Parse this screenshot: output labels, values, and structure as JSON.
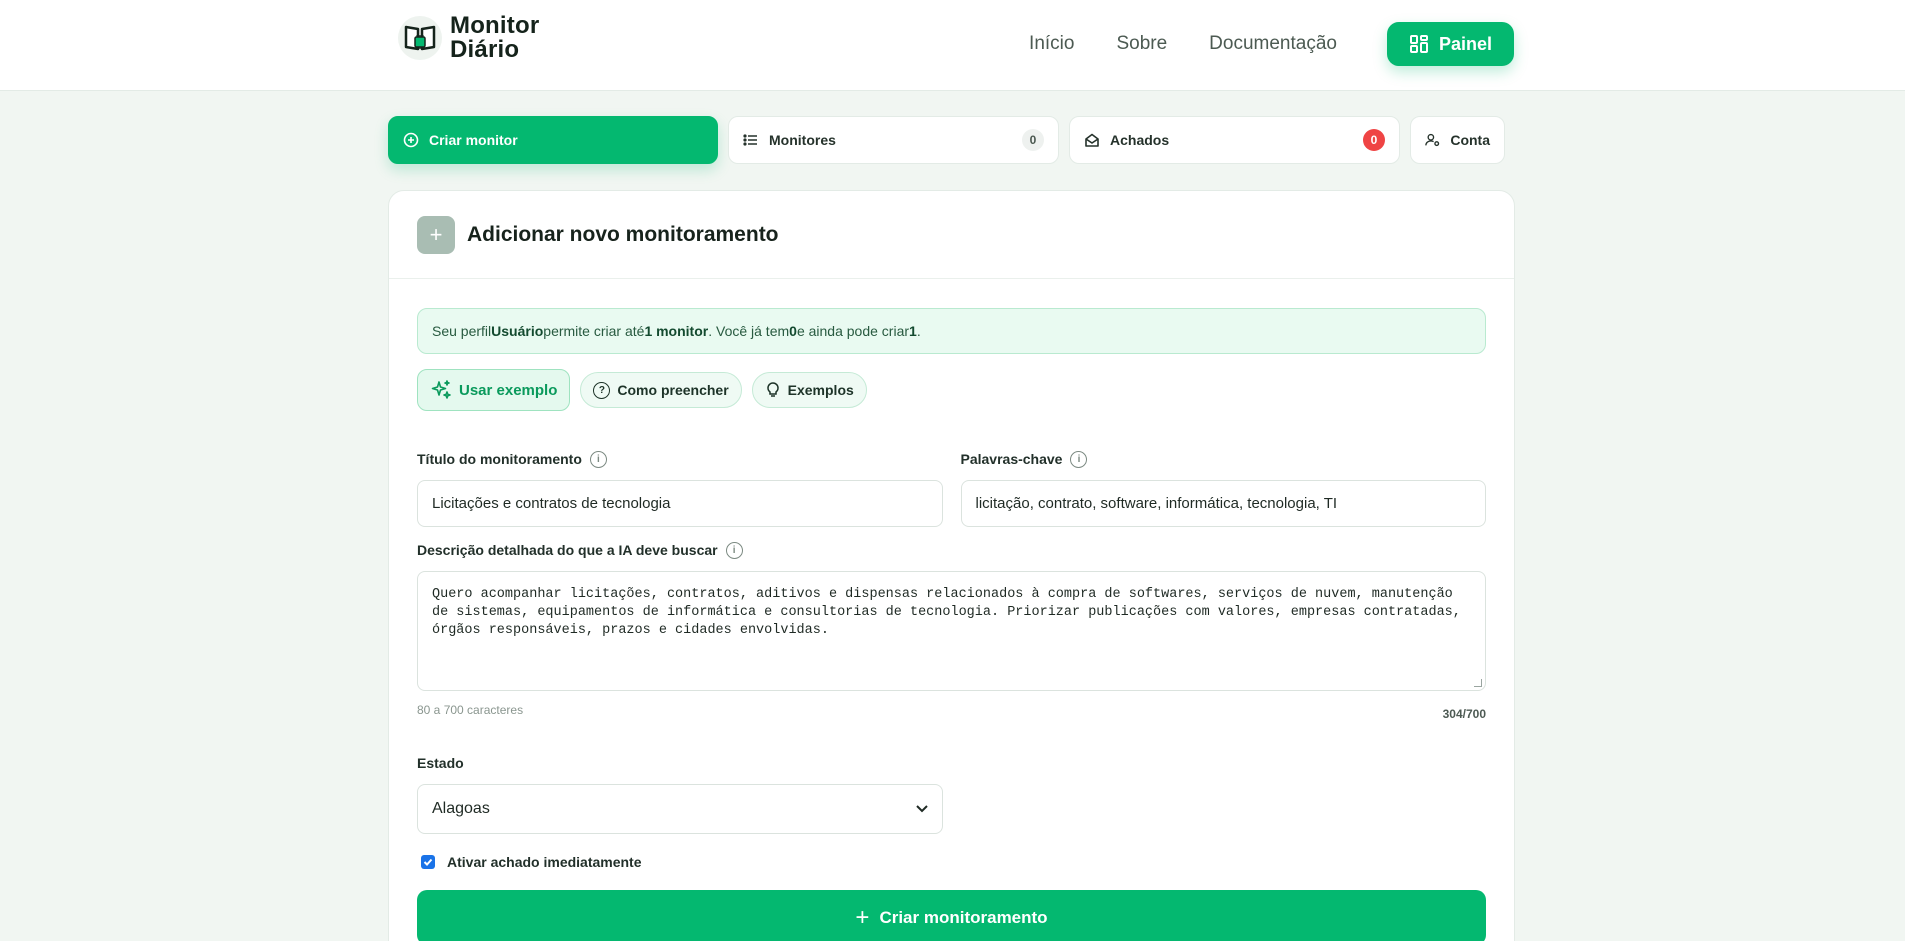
{
  "brand": {
    "line1": "Monitor",
    "line2": "Diário"
  },
  "nav": {
    "links": [
      "Início",
      "Sobre",
      "Documentação"
    ],
    "painel_label": "Painel"
  },
  "tabs": [
    {
      "label": "Criar monitor",
      "icon": "plus-circle-icon",
      "active": true
    },
    {
      "label": "Monitores",
      "icon": "list-icon",
      "count": "0"
    },
    {
      "label": "Achados",
      "icon": "envelope-open-icon",
      "count": "0"
    },
    {
      "label": "Conta",
      "icon": "user-gear-icon"
    }
  ],
  "card": {
    "title": "Adicionar novo monitoramento",
    "notice": {
      "p1": "Seu perfil ",
      "role": "Usuário",
      "p2": " permite criar até ",
      "limit": "1 monitor",
      "p3": ". Você já tem ",
      "have": "0",
      "p4": " e ainda pode criar ",
      "remaining": "1",
      "p5": "."
    },
    "helpers": [
      "Usar exemplo",
      "Como preencher",
      "Exemplos"
    ],
    "title_field": {
      "label": "Título do monitoramento",
      "value": "Licitações e contratos de tecnologia"
    },
    "keywords_field": {
      "label": "Palavras-chave",
      "value": "licitação, contrato, software, informática, tecnologia, TI"
    },
    "description_field": {
      "label": "Descrição detalhada do que a IA deve buscar",
      "value": "Quero acompanhar licitações, contratos, aditivos e dispensas relacionados à compra de softwares, serviços de nuvem, manutenção de sistemas, equipamentos de informática e consultorias de tecnologia. Priorizar publicações com valores, empresas contratadas, órgãos responsáveis, prazos e cidades envolvidas.",
      "hint": "80 a 700 caracteres",
      "counter": "304/700"
    },
    "state_field": {
      "label": "Estado",
      "value": "Alagoas"
    },
    "activate_label": "Ativar achado imediatamente",
    "submit_label": "Criar monitoramento"
  },
  "colors": {
    "accent": "#04b870",
    "badge_red": "#ef4444"
  }
}
